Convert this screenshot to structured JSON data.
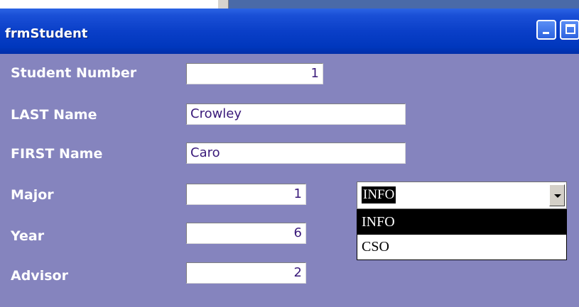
{
  "window": {
    "title": "frmStudent"
  },
  "fields": [
    {
      "label": "Student Number",
      "value": "1"
    },
    {
      "label": "LAST Name",
      "value": "Crowley"
    },
    {
      "label": "FIRST Name",
      "value": "Caro"
    },
    {
      "label": "Major",
      "value": "1"
    },
    {
      "label": "Year",
      "value": "6"
    },
    {
      "label": "Advisor",
      "value": "2"
    }
  ],
  "major_combo": {
    "selected": "INFO",
    "options": [
      "INFO",
      "CSO"
    ]
  },
  "colors": {
    "form_bg": "#8584be",
    "titlebar": "#0a3fc8",
    "text_value": "#3a1a7a"
  },
  "icons": [
    "minimize-icon",
    "maximize-icon",
    "dropdown-arrow-icon"
  ]
}
